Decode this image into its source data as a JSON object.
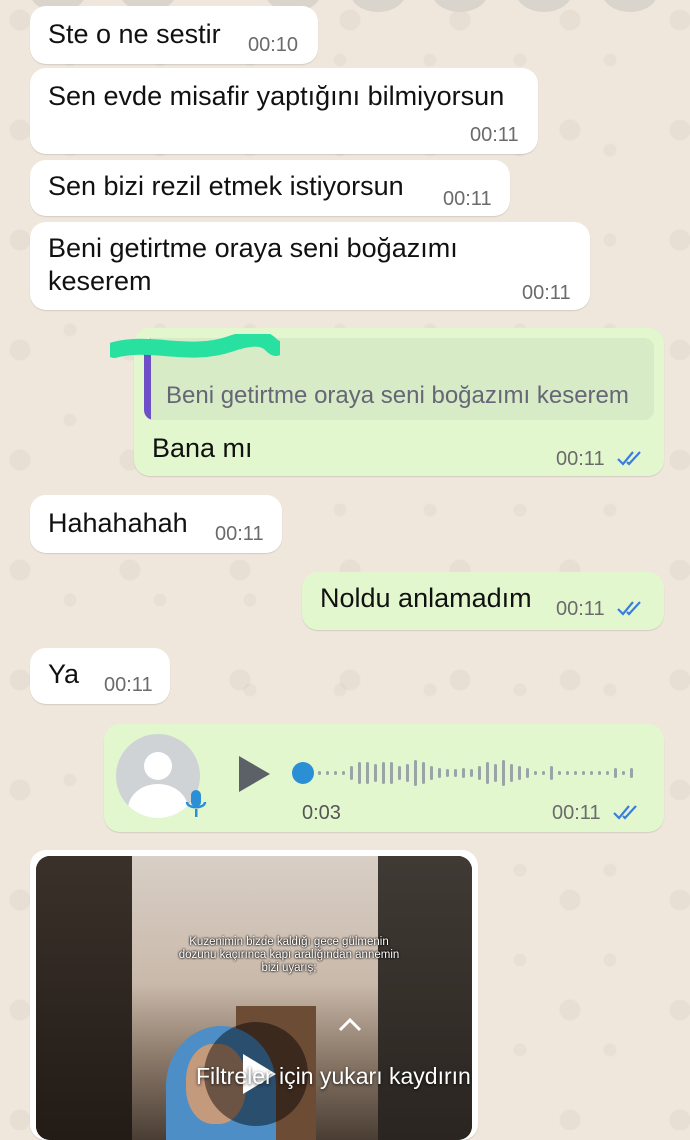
{
  "messages": [
    {
      "text": "Ste o ne sestir",
      "time": "00:10"
    },
    {
      "text": "Sen evde misafir yaptığını bilmiyorsun",
      "time": "00:11"
    },
    {
      "text": "Sen bizi rezil etmek istiyorsun",
      "time": "00:11"
    },
    {
      "text_line1": "Beni getirtme oraya seni boğazımı",
      "text_line2": "keserem",
      "time": "00:11"
    },
    {
      "quoted": "Beni getirtme oraya seni boğazımı keserem",
      "text": "Bana mı",
      "time": "00:11"
    },
    {
      "text": "Hahahahah",
      "time": "00:11"
    },
    {
      "text": "Noldu anlamadım",
      "time": "00:11"
    },
    {
      "text": "Ya",
      "time": "00:11"
    }
  ],
  "voice_note": {
    "duration": "0:03",
    "time": "00:11",
    "progress": 0
  },
  "video": {
    "caption": "Kuzenimin bizde kaldığı gece gülmenin dozunu kaçırınca kapı aralığından annemin bizi uyarış;",
    "overlay_text": "Filtreler için yukarı kaydırın"
  },
  "colors": {
    "incoming": "#ffffff",
    "outgoing": "#e3f7cf",
    "ticks": "#3b7ddd",
    "quote_bar": "#6f4fc8"
  }
}
